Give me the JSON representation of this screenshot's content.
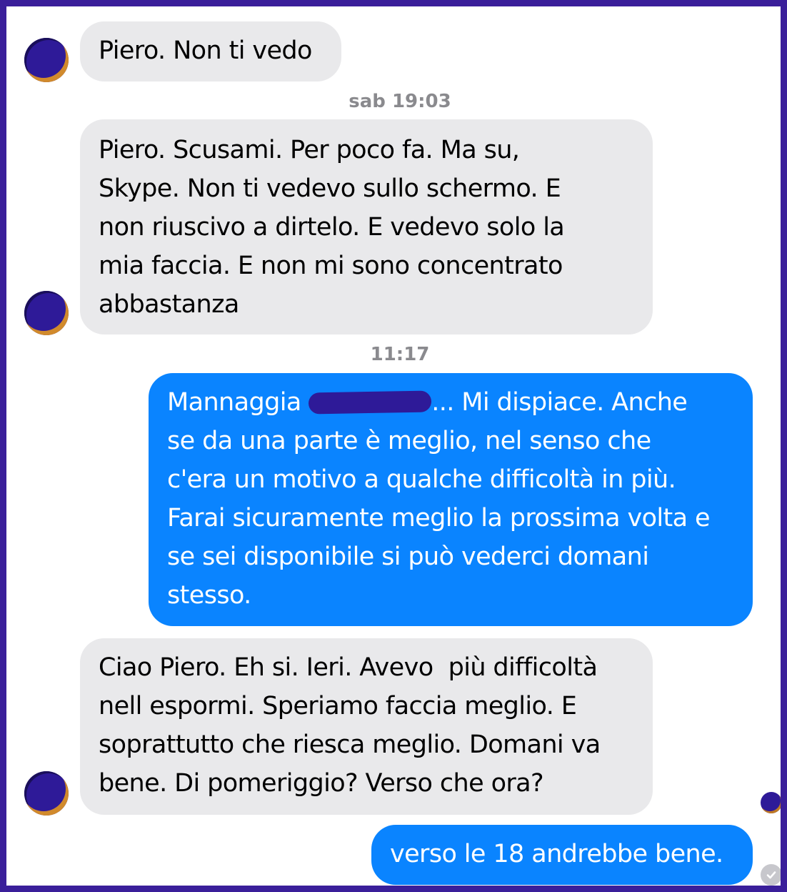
{
  "conversation": {
    "messages": [
      {
        "direction": "incoming",
        "lines": [
          "Piero. Non ti vedo"
        ]
      },
      {
        "direction": "incoming",
        "lines": [
          "Piero. Scusami. Per poco fa. Ma su,",
          "Skype. Non ti vedevo sullo schermo. E",
          "non riuscivo a dirtelo. E vedevo solo la",
          "mia faccia. E non mi sono concentrato",
          "abbastanza"
        ]
      },
      {
        "direction": "outgoing",
        "first_line_before": "Mannaggia ",
        "first_line_after": "... Mi dispiace. Anche",
        "lines": [
          "se da una parte è meglio, nel senso che",
          "c'era un motivo a qualche difficoltà in più.",
          "Farai sicuramente meglio la prossima volta e",
          "se sei disponibile si può vederci domani",
          "stesso."
        ]
      },
      {
        "direction": "incoming",
        "lines": [
          "Ciao Piero. Eh si. Ieri. Avevo  più difficoltà",
          "nell espormi. Speriamo faccia meglio. E",
          "soprattutto che riesca meglio. Domani va",
          "bene. Di pomeriggio? Verso che ora?"
        ]
      },
      {
        "direction": "outgoing",
        "lines": [
          "verso le 18 andrebbe bene."
        ]
      }
    ],
    "timestamps": [
      "sab 19:03",
      "11:17"
    ],
    "status": "read"
  },
  "colors": {
    "frame_border": "#3a1f9a",
    "incoming_bubble": "#e9e9eb",
    "outgoing_bubble": "#0a84ff",
    "timestamp_text": "#8a8a8e",
    "redaction": "#2e1a98"
  }
}
